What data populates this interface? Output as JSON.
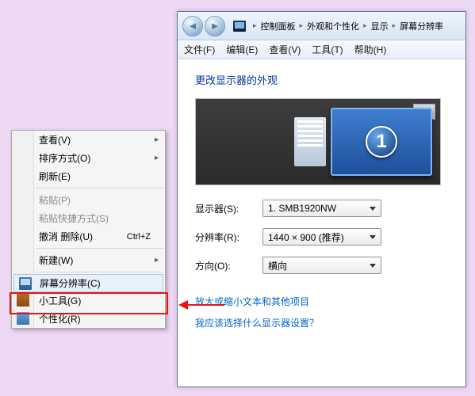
{
  "context_menu": {
    "items": [
      {
        "label": "查看(V)",
        "has_sub": true,
        "icon": null,
        "disabled": false,
        "shortcut": null,
        "sep_before": false
      },
      {
        "label": "排序方式(O)",
        "has_sub": true,
        "icon": null,
        "disabled": false,
        "shortcut": null,
        "sep_before": false
      },
      {
        "label": "刷新(E)",
        "has_sub": false,
        "icon": null,
        "disabled": false,
        "shortcut": null,
        "sep_before": false
      },
      {
        "label": "粘贴(P)",
        "has_sub": false,
        "icon": null,
        "disabled": true,
        "shortcut": null,
        "sep_before": true
      },
      {
        "label": "粘贴快捷方式(S)",
        "has_sub": false,
        "icon": null,
        "disabled": true,
        "shortcut": null,
        "sep_before": false
      },
      {
        "label": "撤消 删除(U)",
        "has_sub": false,
        "icon": null,
        "disabled": false,
        "shortcut": "Ctrl+Z",
        "sep_before": false
      },
      {
        "label": "新建(W)",
        "has_sub": true,
        "icon": null,
        "disabled": false,
        "shortcut": null,
        "sep_before": true
      },
      {
        "label": "屏幕分辨率(C)",
        "has_sub": false,
        "icon": "monitor",
        "disabled": false,
        "shortcut": null,
        "sep_before": true,
        "highlight": true
      },
      {
        "label": "小工具(G)",
        "has_sub": false,
        "icon": "gadget",
        "disabled": false,
        "shortcut": null,
        "sep_before": false
      },
      {
        "label": "个性化(R)",
        "has_sub": false,
        "icon": "personal",
        "disabled": false,
        "shortcut": null,
        "sep_before": false
      }
    ]
  },
  "window": {
    "breadcrumb": [
      "控制面板",
      "外观和个性化",
      "显示",
      "屏幕分辨率"
    ],
    "menubar": [
      "文件(F)",
      "编辑(E)",
      "查看(V)",
      "工具(T)",
      "帮助(H)"
    ],
    "heading": "更改显示器的外观",
    "monitor_number": "1",
    "fields": {
      "display_label": "显示器(S):",
      "display_value": "1. SMB1920NW",
      "resolution_label": "分辨率(R):",
      "resolution_value": "1440 × 900 (推荐)",
      "orientation_label": "方向(O):",
      "orientation_value": "横向"
    },
    "links": {
      "text_size": "放大或缩小文本和其他项目",
      "which_display": "我应该选择什么显示器设置？"
    }
  }
}
